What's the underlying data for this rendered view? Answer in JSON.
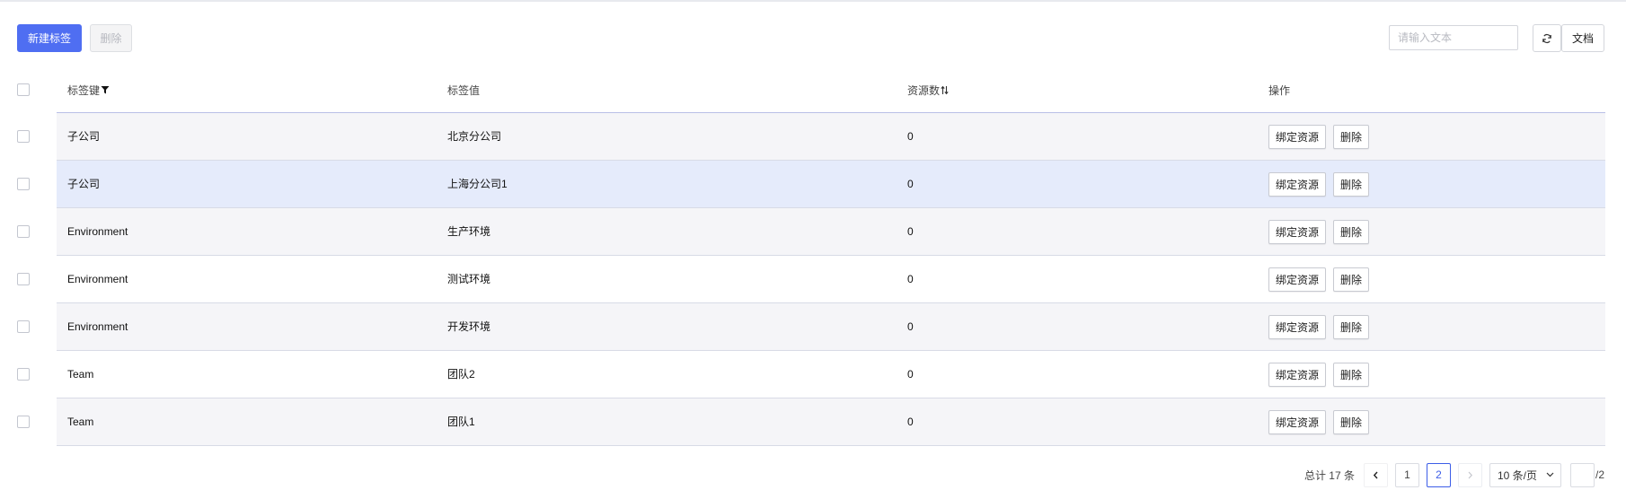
{
  "toolbar": {
    "new_tag_label": "新建标签",
    "delete_label": "删除",
    "search_placeholder": "请输入文本",
    "search_value": "",
    "refresh_icon": "refresh-icon",
    "doc_label": "文档"
  },
  "table": {
    "columns": [
      {
        "label": "标签键",
        "icon": "filter-icon"
      },
      {
        "label": "标签值"
      },
      {
        "label": "资源数",
        "icon": "sort-icon"
      },
      {
        "label": "操作"
      }
    ],
    "rows": [
      {
        "key": "子公司",
        "value": "北京分公司",
        "count": "0",
        "bind_label": "绑定资源",
        "delete_label": "删除",
        "style": "alt"
      },
      {
        "key": "子公司",
        "value": "上海分公司1",
        "count": "0",
        "bind_label": "绑定资源",
        "delete_label": "删除",
        "style": "hl"
      },
      {
        "key": "Environment",
        "value": "生产环境",
        "count": "0",
        "bind_label": "绑定资源",
        "delete_label": "删除",
        "style": "alt"
      },
      {
        "key": "Environment",
        "value": "测试环境",
        "count": "0",
        "bind_label": "绑定资源",
        "delete_label": "删除",
        "style": ""
      },
      {
        "key": "Environment",
        "value": "开发环境",
        "count": "0",
        "bind_label": "绑定资源",
        "delete_label": "删除",
        "style": "alt"
      },
      {
        "key": "Team",
        "value": "团队2",
        "count": "0",
        "bind_label": "绑定资源",
        "delete_label": "删除",
        "style": ""
      },
      {
        "key": "Team",
        "value": "团队1",
        "count": "0",
        "bind_label": "绑定资源",
        "delete_label": "删除",
        "style": "alt"
      }
    ]
  },
  "pagination": {
    "total_text": "总计 17 条",
    "pages": [
      "1",
      "2"
    ],
    "current_page": "2",
    "page_size_label": "10 条/页",
    "jump_value": "",
    "pages_total_text": "/2"
  },
  "colors": {
    "primary": "#4f6ef2",
    "active_page": "#3c5de8",
    "row_highlight": "#e5ebfb",
    "row_alt": "#f5f5f8"
  }
}
